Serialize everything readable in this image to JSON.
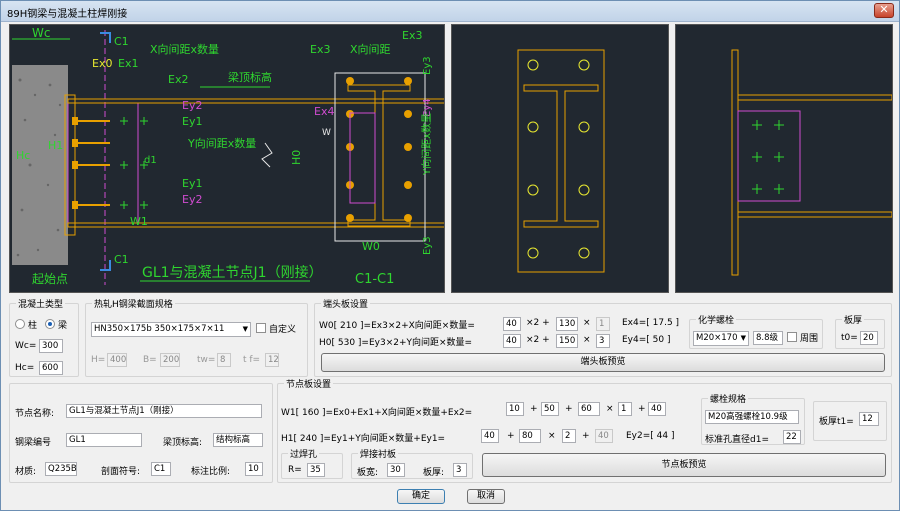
{
  "window": {
    "title": "89H钢梁与混凝土柱焊刚接",
    "close_glyph": "✕"
  },
  "drawing_main": {
    "wc": "Wc",
    "c1_top": "C1",
    "c1_bottom": "C1",
    "x_spacing_count": "X向间距x数量",
    "ex0": "Ex0",
    "ex1": "Ex1",
    "ex2": "Ex2",
    "beam_top_elev": "梁顶标高",
    "ey2_top": "Ey2",
    "ey1_top": "Ey1",
    "y_spacing_count": "Y向间距x数量",
    "ey1_bottom": "Ey1",
    "ey2_bottom": "Ey2",
    "hc": "Hc",
    "h1": "H1",
    "d1": "d1",
    "w1": "W1",
    "start_point": "起始点",
    "caption": "GL1与混凝土节点J1（刚接）"
  },
  "drawing_section": {
    "ex3_left": "Ex3",
    "x_spacing": "X向间距",
    "ex3_right": "Ex3",
    "ey3_top": "Ey3",
    "ex4": "Ex4",
    "ey4": "Ey4",
    "weld_mark": "W",
    "h0": "H0",
    "y_spacing_count": "Y向间距x数量",
    "w0": "W0",
    "ey3_bottom": "Ey3",
    "caption": "C1-C1"
  },
  "concrete_type": {
    "title": "混凝土类型",
    "opt_column": "柱",
    "opt_beam": "梁",
    "selected": "梁",
    "wc_label": "Wc=",
    "wc_value": "300",
    "hc_label": "Hc=",
    "hc_value": "600"
  },
  "hot_rolled": {
    "title": "热轧H钢梁截面规格",
    "selected": "HN350×175b    350×175×7×11",
    "custom_label": "自定义",
    "h_label": "H=",
    "h_value": "400",
    "b_label": "B=",
    "b_value": "200",
    "tw_label": "tw=",
    "tw_value": "8",
    "tf_label": "t f=",
    "tf_value": "12"
  },
  "end_plate": {
    "title": "端头板设置",
    "w0_formula": "W0[   210   ]=Ex3×2+X向间距×数量=",
    "w0_ex3": "40",
    "w0_x2": "×2  +",
    "w0_spacing": "130",
    "w0_times": "×",
    "w0_count": "1",
    "ex4_label": "Ex4=[    17.5   ]",
    "h0_formula": "H0[   530   ]=Ey3×2+Y向间距×数量=",
    "h0_ey3": "40",
    "h0_x2": "×2  +",
    "h0_spacing": "150",
    "h0_times": "×",
    "h0_count": "3",
    "ey4_label": "Ey4=[    50    ]",
    "bolt_title": "化学螺栓",
    "bolt_selected": "M20×170",
    "bolt_grade": "8.8级",
    "around_label": "周围",
    "thickness_title": "板厚",
    "t0_label": "t0=",
    "t0_value": "20",
    "preview_button": "端头板预览"
  },
  "node_info": {
    "name_label": "节点名称:",
    "name_value": "GL1与混凝土节点J1（刚接）",
    "beam_no_label": "钢梁编号",
    "beam_no_value": "GL1",
    "beam_elev_label": "梁顶标高:",
    "beam_elev_value": "结构标高",
    "material_label": "材质:",
    "material_value": "Q235B",
    "section_label": "剖面符号:",
    "section_value": "C1",
    "scale_label": "标注比例:",
    "scale_value": "10"
  },
  "node_plate": {
    "title": "节点板设置",
    "w1_formula": "W1[   160   ]=Ex0+Ex1+X向间距×数量+Ex2=",
    "w1_ex0": "10",
    "w1_plus1": "+",
    "w1_ex1": "50",
    "w1_plus2": "+",
    "w1_spacing": "60",
    "w1_times": "×",
    "w1_count": "1",
    "w1_plus3": "+",
    "w1_ex2": "40",
    "h1_formula": "H1[   240   ]=Ey1+Y向间距×数量+Ey1=",
    "h1_ey1": "40",
    "h1_plus1": "+",
    "h1_spacing": "80",
    "h1_times": "×",
    "h1_count": "2",
    "h1_plus2": "+",
    "h1_ey1b": "40",
    "ey2_label": "Ey2=[    44    ]",
    "bolt_title": "螺栓规格",
    "bolt_value": "M20高强螺栓10.9级",
    "hole_label": "标准孔直径d1=",
    "hole_value": "22",
    "thickness_label": "板厚t1=",
    "thickness_value": "12",
    "weld_hole_title": "过焊孔",
    "weld_hole_r_label": "R=",
    "weld_hole_r_value": "35",
    "backing_title": "焊接衬板",
    "backing_w_label": "板宽:",
    "backing_w_value": "30",
    "backing_t_label": "板厚:",
    "backing_t_value": "3",
    "preview_button": "节点板预览"
  },
  "footer": {
    "ok": "确定",
    "cancel": "取消"
  },
  "colors": {
    "canvas_bg": "#212830",
    "bolt": "#e8a000",
    "green": "#2fd62f",
    "orange": "#e8a000",
    "magenta": "#d04cd0",
    "cyan_arrow": "#3b8be0"
  }
}
